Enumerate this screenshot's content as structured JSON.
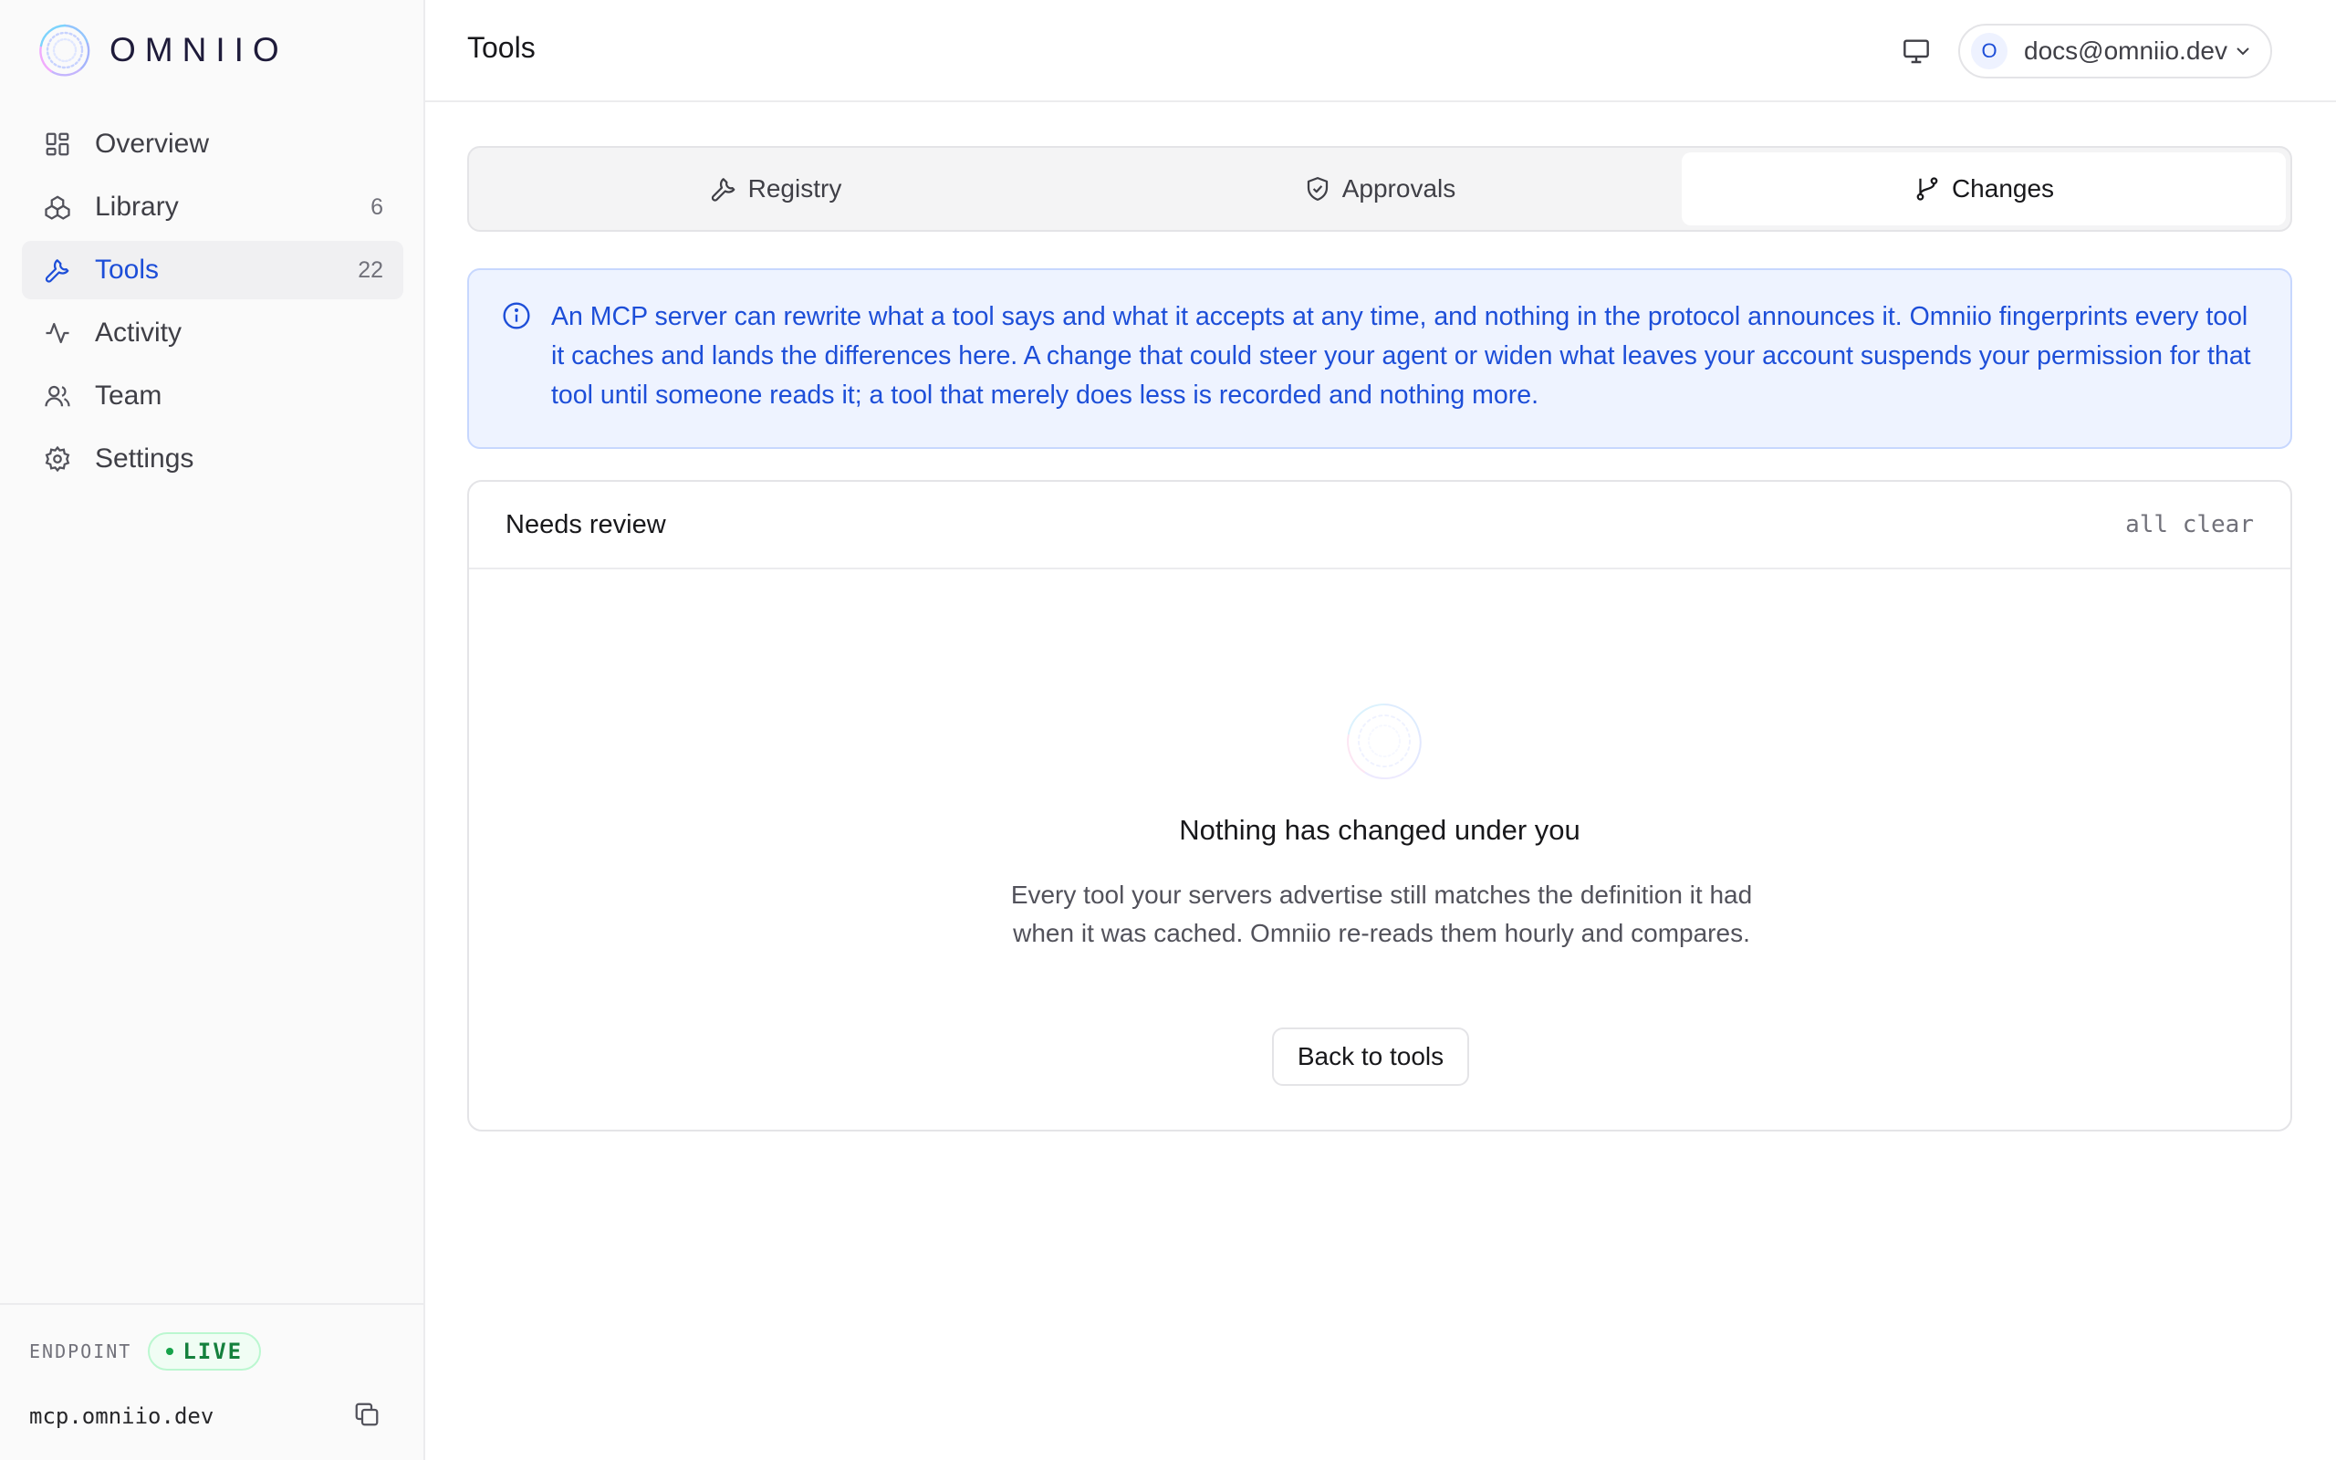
{
  "brand": {
    "name": "OMNIIO"
  },
  "sidebar": {
    "items": [
      {
        "label": "Overview",
        "count": "",
        "icon": "grid-icon"
      },
      {
        "label": "Library",
        "count": "6",
        "icon": "blocks-icon"
      },
      {
        "label": "Tools",
        "count": "22",
        "icon": "wrench-icon",
        "active": true
      },
      {
        "label": "Activity",
        "count": "",
        "icon": "activity-icon"
      },
      {
        "label": "Team",
        "count": "",
        "icon": "users-icon"
      },
      {
        "label": "Settings",
        "count": "",
        "icon": "gear-icon"
      }
    ],
    "footer": {
      "endpoint_label": "ENDPOINT",
      "live_label": "LIVE",
      "url": "mcp.omniio.dev"
    }
  },
  "header": {
    "title": "Tools",
    "account": {
      "initial": "O",
      "email": "docs@omniio.dev"
    }
  },
  "tabs": [
    {
      "label": "Registry",
      "icon": "wrench-icon"
    },
    {
      "label": "Approvals",
      "icon": "shield-check-icon"
    },
    {
      "label": "Changes",
      "icon": "git-branch-icon",
      "active": true
    }
  ],
  "info": {
    "text": "An MCP server can rewrite what a tool says and what it accepts at any time, and nothing in the protocol announces it. Omniio fingerprints every tool it caches and lands the differences here. A change that could steer your agent or widen what leaves your account suspends your permission for that tool until someone reads it; a tool that merely does less is recorded and nothing more."
  },
  "review": {
    "title": "Needs review",
    "status": "all clear",
    "empty_title": "Nothing has changed under you",
    "empty_text": "Every tool your servers advertise still matches the definition it had when it was cached. Omniio re-reads them hourly and compares.",
    "back_label": "Back to tools"
  },
  "colors": {
    "accent": "#1d4ed8",
    "live": "#15803d",
    "info_bg": "#eef3ff"
  }
}
